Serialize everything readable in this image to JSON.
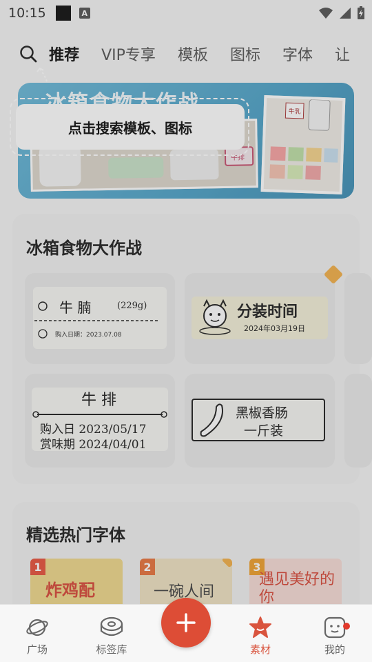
{
  "status_bar": {
    "time": "10:15",
    "a_badge": "A"
  },
  "nav": {
    "tabs": [
      {
        "label": "推荐",
        "active": true
      },
      {
        "label": "VIP专享",
        "active": false
      },
      {
        "label": "模板",
        "active": false
      },
      {
        "label": "图标",
        "active": false
      },
      {
        "label": "字体",
        "active": false
      },
      {
        "label": "让",
        "active": false
      }
    ]
  },
  "banner": {
    "title": "冰箱食物大作战",
    "tag_left": "牛排",
    "tag_right": "牛乳"
  },
  "search_hint": {
    "text": "点击搜索模板、图标"
  },
  "section1": {
    "title": "冰箱食物大作战",
    "cards": [
      {
        "title": "牛 腩",
        "weight": "(229g)",
        "meta": "购入日期：2023.07.08"
      },
      {
        "title": "分装时间",
        "date": "2024年03月19日"
      },
      {
        "title": "牛 排",
        "line1": "购入日 2023/05/17",
        "line2": "赏味期 2024/04/01"
      },
      {
        "line1": "黑椒香肠",
        "line2": "一斤装"
      }
    ]
  },
  "section2": {
    "title": "精选热门字体",
    "fonts": [
      {
        "rank": "1",
        "sample": "炸鸡配",
        "color": "#f0d88c"
      },
      {
        "rank": "2",
        "sample": "一碗人间",
        "color": "#efe2c2"
      },
      {
        "rank": "3",
        "sample": "遇见美好的你",
        "color": "#f7dcd6"
      }
    ]
  },
  "bottom_nav": {
    "items": [
      {
        "label": "广场",
        "icon": "planet-icon"
      },
      {
        "label": "标签库",
        "icon": "tape-icon"
      },
      {
        "label": "素材",
        "icon": "star-icon",
        "active": true
      },
      {
        "label": "我的",
        "icon": "face-icon"
      }
    ],
    "fab_icon": "plus-icon"
  },
  "colors": {
    "accent": "#dd4d36",
    "banner_blue": "#4fa3c8",
    "vip": "#f3b04a"
  }
}
